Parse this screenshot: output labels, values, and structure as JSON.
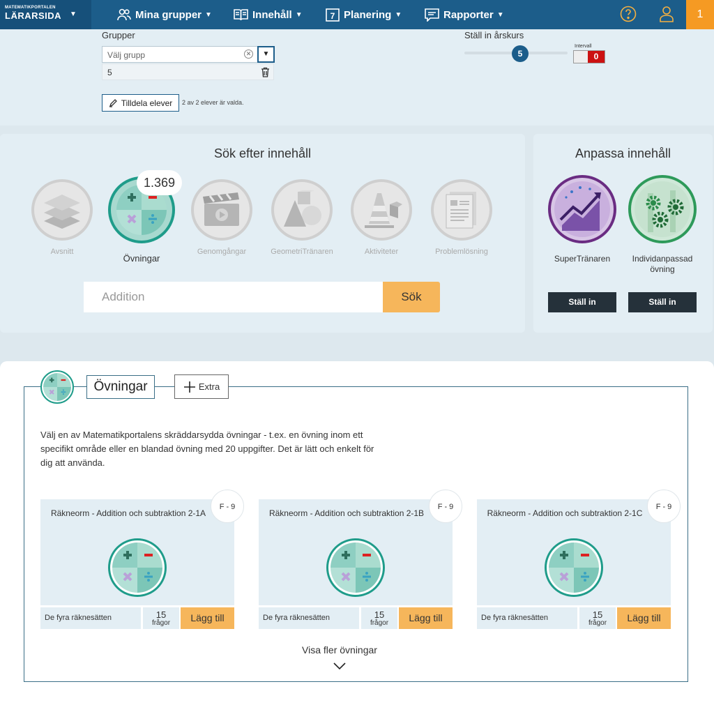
{
  "nav": {
    "logo_small": "MATEMATIKPORTALEN",
    "logo_big": "LÄRARSIDA",
    "items": [
      {
        "label": "Mina grupper",
        "icon": "users-icon"
      },
      {
        "label": "Innehåll",
        "icon": "book-icon"
      },
      {
        "label": "Planering",
        "icon": "calendar-icon",
        "icon_text": "7"
      },
      {
        "label": "Rapporter",
        "icon": "message-icon"
      }
    ],
    "help_icon": "help-icon",
    "user_icon": "user-icon",
    "badge": "1"
  },
  "settings": {
    "groups_label": "Grupper",
    "select_placeholder": "Välj grupp",
    "selected_group": "5",
    "assign_button": "Tilldela elever",
    "assign_info": "2 av 2 elever är valda.",
    "grade_label": "Ställ in årskurs",
    "grade_value": "5",
    "interval_label": "Intervall",
    "interval_value": "0"
  },
  "search": {
    "title": "Sök efter innehåll",
    "count": "1.369",
    "categories": [
      {
        "label": "Avsnitt",
        "icon": "layers-icon",
        "active": false
      },
      {
        "label": "Övningar",
        "icon": "math-operations-icon",
        "active": true
      },
      {
        "label": "Genomgångar",
        "icon": "clapperboard-icon",
        "active": false
      },
      {
        "label": "GeometriTränaren",
        "icon": "geometry-shapes-icon",
        "active": false
      },
      {
        "label": "Aktiviteter",
        "icon": "cone-icon",
        "active": false
      },
      {
        "label": "Problemlösning",
        "icon": "document-icon",
        "active": false
      }
    ],
    "input_placeholder": "Addition",
    "button": "Sök"
  },
  "adapt": {
    "title": "Anpassa innehåll",
    "items": [
      {
        "label": "SuperTränaren",
        "button": "Ställ in",
        "icon": "trend-chart-icon"
      },
      {
        "label": "Individanpassad övning",
        "button": "Ställ in",
        "icon": "gears-icon"
      }
    ]
  },
  "results": {
    "title": "Övningar",
    "extra_button": "Extra",
    "description": "Välj en av Matematikportalens skräddarsydda övningar - t.ex. en övning inom ett specifikt område eller en blandad övning med 20 uppgifter. Det är lätt och enkelt för dig att använda.",
    "cards": [
      {
        "title": "Räkneorm - Addition och subtraktion 2-1A",
        "grade": "F - 9",
        "category": "De fyra räknesätten",
        "count": "15",
        "count_unit": "frågor",
        "button": "Lägg till"
      },
      {
        "title": "Räkneorm - Addition och subtraktion 2-1B",
        "grade": "F - 9",
        "category": "De fyra räknesätten",
        "count": "15",
        "count_unit": "frågor",
        "button": "Lägg till"
      },
      {
        "title": "Räkneorm - Addition och subtraktion 2-1C",
        "grade": "F - 9",
        "category": "De fyra räknesätten",
        "count": "15",
        "count_unit": "frågor",
        "button": "Lägg till"
      }
    ],
    "show_more": "Visa fler övningar"
  },
  "colors": {
    "nav": "#1c5d8a",
    "accent": "#f59a23",
    "button": "#f6b65b",
    "teal": "#1f9c8a",
    "dark_button": "#25313a"
  }
}
